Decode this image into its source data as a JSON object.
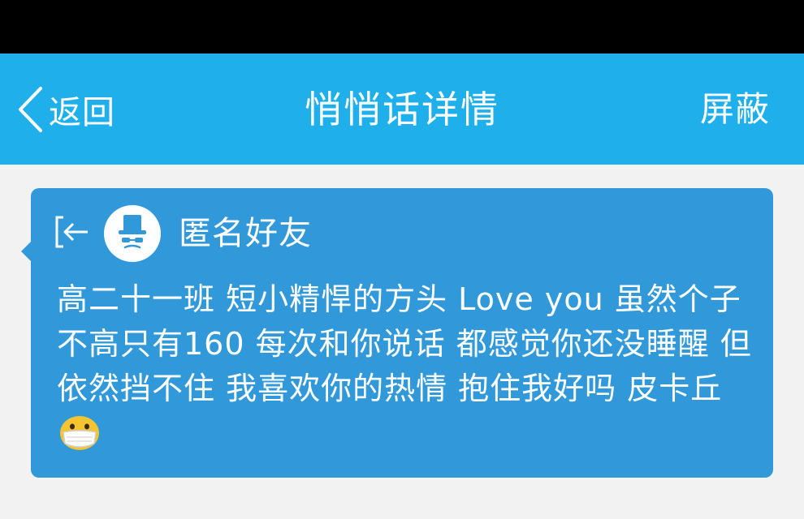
{
  "header": {
    "back_label": "返回",
    "title": "悄悄话详情",
    "block_label": "屏蔽"
  },
  "message": {
    "sender": "匿名好友",
    "text": "高二十一班 短小精悍的方头 Love you 虽然个子不高只有160 每次和你说话 都感觉你还没睡醒  但依然挡不住 我喜欢你的热情  抱住我好吗 皮卡丘",
    "emoji": "face-with-medical-mask-icon"
  },
  "colors": {
    "status_bar": "#000000",
    "nav_bar": "#1fb0ec",
    "bubble": "#3199da",
    "background": "#f2f2f2",
    "text_on_blue": "#ffffff"
  }
}
